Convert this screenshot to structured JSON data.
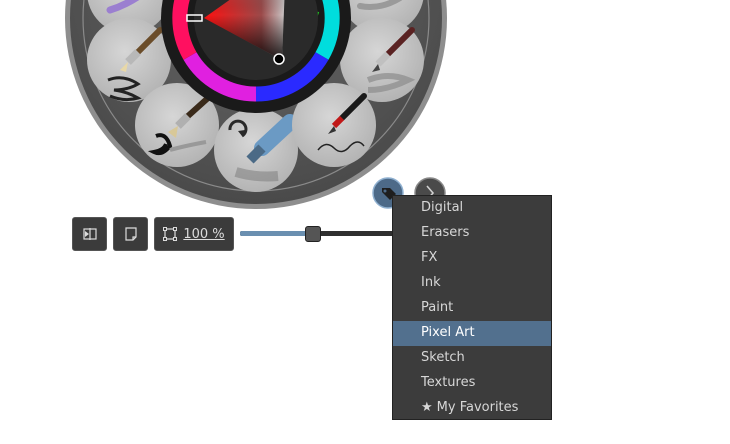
{
  "palette": {
    "tag_button_icon": "tag-icon",
    "next_button_icon": "chevron-right-icon",
    "rotate_icon": "rotate-icon",
    "selected_color": "#e8141a",
    "brushes": [
      {
        "name": "brush-preset-bristle"
      },
      {
        "name": "brush-preset-pencil-smudge"
      },
      {
        "name": "brush-preset-fan-brush"
      },
      {
        "name": "brush-preset-marker"
      },
      {
        "name": "brush-preset-ink-pen"
      },
      {
        "name": "brush-preset-top-left"
      },
      {
        "name": "brush-preset-top-right"
      }
    ]
  },
  "toolbar": {
    "mirror_icon": "mirror-view-icon",
    "canvas_icon": "canvas-only-icon",
    "zoom_icon": "crop-frame-icon",
    "zoom_label": "100 %",
    "zoom_level": 0.45
  },
  "tag_menu": {
    "items": [
      {
        "label": "Digital",
        "selected": false
      },
      {
        "label": "Erasers",
        "selected": false
      },
      {
        "label": "FX",
        "selected": false
      },
      {
        "label": "Ink",
        "selected": false
      },
      {
        "label": "Paint",
        "selected": false
      },
      {
        "label": "Pixel Art",
        "selected": true
      },
      {
        "label": "Sketch",
        "selected": false
      },
      {
        "label": "Textures",
        "selected": false
      },
      {
        "label": "My Favorites",
        "selected": false,
        "icon": "star-icon"
      }
    ]
  }
}
